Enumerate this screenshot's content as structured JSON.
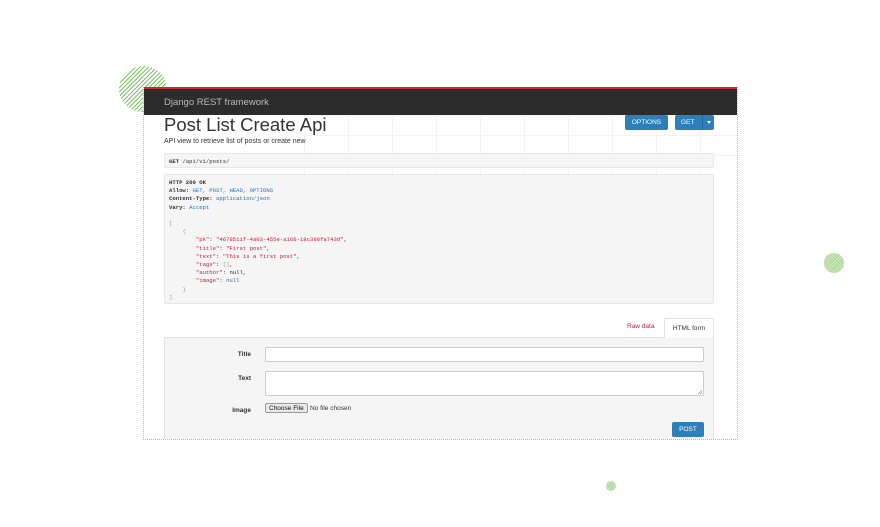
{
  "navbar": {
    "brand": "Django REST framework"
  },
  "page": {
    "title": "Post List Create Api",
    "description": "API view to retrieve list of posts or create new"
  },
  "actions": {
    "options_label": "OPTIONS",
    "get_label": "GET"
  },
  "request": {
    "method": "GET",
    "path": "/api/v1/posts/"
  },
  "response": {
    "status": "HTTP 200 OK",
    "headers": [
      {
        "name": "Allow:",
        "value": "GET, POST, HEAD, OPTIONS"
      },
      {
        "name": "Content-Type:",
        "value": "application/json"
      },
      {
        "name": "Vary:",
        "value": "Accept"
      }
    ],
    "body": {
      "pk": "\"4678511f-4a03-455e-a166-18c396fa743d\"",
      "title": "\"First post\"",
      "text": "\"This is a first post\"",
      "tags": "[]",
      "author": "null",
      "image": "null"
    }
  },
  "tabs": {
    "raw": "Raw data",
    "html": "HTML form"
  },
  "form": {
    "title_label": "Title",
    "text_label": "Text",
    "image_label": "Image",
    "choose_file": "Choose File",
    "file_status": "No file chosen",
    "submit_label": "POST"
  },
  "colors": {
    "navbar": "#2c2c2c",
    "accent_red": "#c62b2b",
    "primary_button": "#2c7fb8",
    "string_red": "#d1143a",
    "literal_blue": "#1f6fb1"
  }
}
